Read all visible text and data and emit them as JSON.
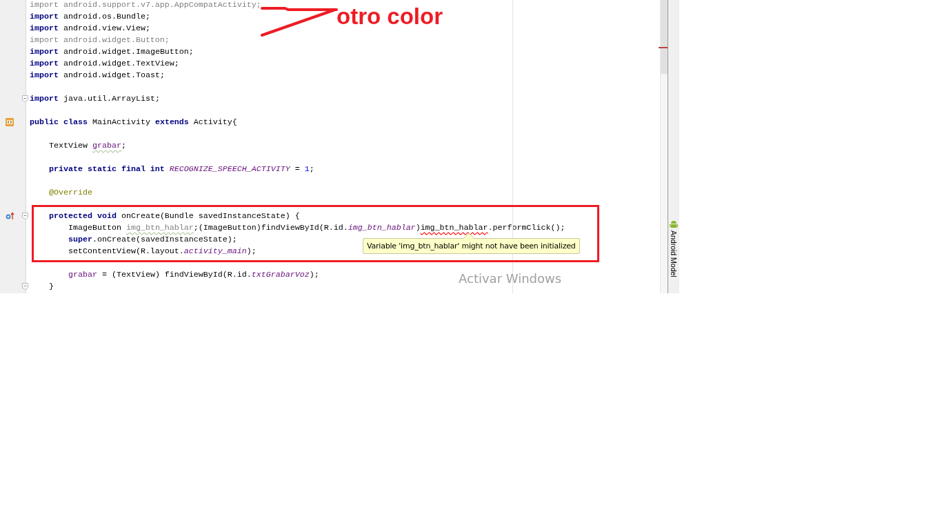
{
  "editor": {
    "lines": [
      {
        "kind": "code",
        "fold": false,
        "segments": [
          {
            "text": "import android.support.v7.app.AppCompatActivity;",
            "kind": "unused"
          }
        ]
      },
      {
        "kind": "code",
        "fold": false,
        "segments": [
          {
            "text": "import",
            "kind": "keyword"
          },
          {
            "text": " android.os.Bundle;",
            "kind": "plain"
          }
        ]
      },
      {
        "kind": "code",
        "fold": false,
        "segments": [
          {
            "text": "import",
            "kind": "keyword"
          },
          {
            "text": " android.view.View;",
            "kind": "plain"
          }
        ]
      },
      {
        "kind": "code",
        "fold": false,
        "segments": [
          {
            "text": "import android.widget.Button;",
            "kind": "unused"
          }
        ]
      },
      {
        "kind": "code",
        "fold": false,
        "segments": [
          {
            "text": "import",
            "kind": "keyword"
          },
          {
            "text": " android.widget.ImageButton;",
            "kind": "plain"
          }
        ]
      },
      {
        "kind": "code",
        "fold": false,
        "segments": [
          {
            "text": "import",
            "kind": "keyword"
          },
          {
            "text": " android.widget.TextView;",
            "kind": "plain"
          }
        ]
      },
      {
        "kind": "code",
        "fold": false,
        "segments": [
          {
            "text": "import",
            "kind": "keyword"
          },
          {
            "text": " android.widget.Toast;",
            "kind": "plain"
          }
        ]
      },
      {
        "kind": "blank",
        "fold": false
      },
      {
        "kind": "code",
        "fold": true,
        "segments": [
          {
            "text": "import",
            "kind": "keyword"
          },
          {
            "text": " java.util.ArrayList;",
            "kind": "plain"
          }
        ]
      },
      {
        "kind": "blank",
        "fold": false
      },
      {
        "kind": "class",
        "fold": false,
        "segments": [
          {
            "text": "public class",
            "kind": "keyword"
          },
          {
            "text": " MainActivity ",
            "kind": "plain"
          },
          {
            "text": "extends",
            "kind": "keyword"
          },
          {
            "text": " Activity{",
            "kind": "plain"
          }
        ]
      },
      {
        "kind": "blank",
        "fold": false
      },
      {
        "kind": "code",
        "fold": false,
        "segments": [
          {
            "text": "    TextView ",
            "kind": "plain"
          },
          {
            "text": "grabar",
            "kind": "field_warn"
          },
          {
            "text": ";",
            "kind": "plain"
          }
        ]
      },
      {
        "kind": "blank",
        "fold": false
      },
      {
        "kind": "code",
        "fold": false,
        "segments": [
          {
            "text": "    private static final int",
            "kind": "keyword"
          },
          {
            "text": " RECOGNIZE_SPEECH_ACTIVITY",
            "kind": "static"
          },
          {
            "text": " = ",
            "kind": "plain"
          },
          {
            "text": "1",
            "kind": "number"
          },
          {
            "text": ";",
            "kind": "plain"
          }
        ]
      },
      {
        "kind": "blank",
        "fold": false
      },
      {
        "kind": "code",
        "fold": false,
        "segments": [
          {
            "text": "    @Override",
            "kind": "annotation"
          }
        ]
      },
      {
        "kind": "blank",
        "fold": false
      },
      {
        "kind": "override",
        "fold": true,
        "segments": [
          {
            "text": "    protected void",
            "kind": "keyword"
          },
          {
            "text": " onCreate(Bundle savedInstanceState) {",
            "kind": "plain"
          }
        ]
      },
      {
        "kind": "code",
        "fold": false,
        "segments": [
          {
            "text": "        ImageButton ",
            "kind": "plain"
          },
          {
            "text": "img_btn_hablar",
            "kind": "unused_warn"
          },
          {
            "text": ";(ImageButton)findViewById(R.id.",
            "kind": "plain"
          },
          {
            "text": "img_btn_hablar",
            "kind": "static"
          },
          {
            "text": ")",
            "kind": "plain"
          },
          {
            "text": "img_btn_hablar",
            "kind": "error"
          },
          {
            "text": ".performClick();",
            "kind": "plain"
          }
        ]
      },
      {
        "kind": "code",
        "fold": false,
        "segments": [
          {
            "text": "        super",
            "kind": "keyword"
          },
          {
            "text": ".onCreate(savedInstanceState);",
            "kind": "plain"
          }
        ]
      },
      {
        "kind": "code",
        "fold": false,
        "segments": [
          {
            "text": "        setContentView(R.layout.",
            "kind": "plain"
          },
          {
            "text": "activity_main",
            "kind": "static"
          },
          {
            "text": ");",
            "kind": "plain"
          }
        ]
      },
      {
        "kind": "blank",
        "fold": false
      },
      {
        "kind": "code",
        "fold": false,
        "segments": [
          {
            "text": "        grabar",
            "kind": "field"
          },
          {
            "text": " = (TextView) findViewById(R.id.",
            "kind": "plain"
          },
          {
            "text": "txtGrabarVoz",
            "kind": "static"
          },
          {
            "text": ");",
            "kind": "plain"
          }
        ]
      },
      {
        "kind": "code",
        "fold": true,
        "segments": [
          {
            "text": "    }",
            "kind": "plain"
          }
        ]
      }
    ],
    "tooltip": "Variable 'img_btn_hablar' might not have been initialized"
  },
  "side_panel": {
    "label": "Android Model"
  },
  "annotation": {
    "text": "otro color"
  },
  "os_notice": "Activar Windows"
}
